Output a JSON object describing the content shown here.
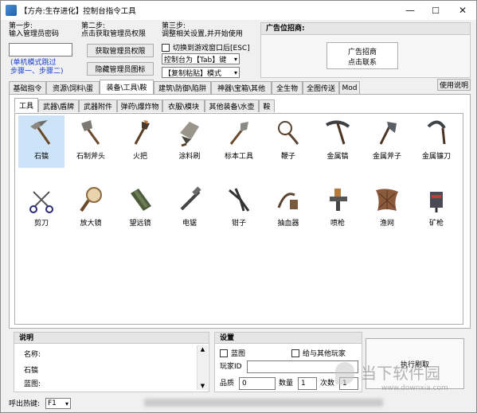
{
  "window": {
    "title": "【方舟:生存进化】控制台指令工具",
    "minimize": "—",
    "maximize": "☐",
    "close": "✕"
  },
  "step1": {
    "title": "第一步:",
    "desc": "输入管理员密码",
    "input_value": "",
    "note_line1": "(单机模式跳过",
    "note_line2": "步骤一、步骤二)"
  },
  "step2": {
    "title": "第二步:",
    "desc": "点击获取管理员权限",
    "get_admin_label": "获取管理员权限",
    "hide_icon_label": "隐藏管理员图标"
  },
  "step3": {
    "title": "第三步:",
    "desc": "调整相关设置,并开始使用",
    "switch_label": "切换到游戏窗口后[ESC]",
    "console_key_label": "控制台为【Tab】键",
    "paste_mode_label": "【复制粘贴】模式"
  },
  "ad": {
    "header": "广告位招商:",
    "box_line1": "广告招商",
    "box_line2": "点击联系"
  },
  "main_tabs": [
    "基础指令",
    "资源\\饲料\\蛋",
    "装备\\工具\\鞍",
    "建筑\\防御\\陷阱",
    "神器\\宝箱\\其他",
    "全生物",
    "全图传送",
    "Mod"
  ],
  "help_button": "使用说明",
  "sub_tabs": [
    "工具",
    "武器\\盾牌",
    "武器附件",
    "弹药\\爆炸物",
    "衣服\\模块",
    "其他装备\\水壶",
    "鞍"
  ],
  "items": [
    {
      "label": "石镐",
      "icon": "stone-pick-icon"
    },
    {
      "label": "石制斧头",
      "icon": "stone-hatchet-icon"
    },
    {
      "label": "火把",
      "icon": "torch-icon"
    },
    {
      "label": "涂料刷",
      "icon": "paintbrush-icon"
    },
    {
      "label": "标本工具",
      "icon": "specimen-tool-icon"
    },
    {
      "label": "鞭子",
      "icon": "whip-icon"
    },
    {
      "label": "金属镐",
      "icon": "metal-pick-icon"
    },
    {
      "label": "金属斧子",
      "icon": "metal-hatchet-icon"
    },
    {
      "label": "金属镰刀",
      "icon": "metal-sickle-icon"
    },
    {
      "label": "剪刀",
      "icon": "scissors-icon"
    },
    {
      "label": "放大镜",
      "icon": "magnifying-glass-icon"
    },
    {
      "label": "望远镜",
      "icon": "spyglass-icon"
    },
    {
      "label": "电锯",
      "icon": "chainsaw-icon"
    },
    {
      "label": "钳子",
      "icon": "pliers-icon"
    },
    {
      "label": "抽血器",
      "icon": "blood-extractor-icon"
    },
    {
      "label": "喷枪",
      "icon": "spray-gun-icon"
    },
    {
      "label": "渔网",
      "icon": "fishing-net-icon"
    },
    {
      "label": "矿枪",
      "icon": "mining-drill-icon"
    }
  ],
  "description": {
    "header": "说明",
    "name_label": "名称:",
    "name_value": "石镐",
    "blueprint_label": "蓝图:"
  },
  "settings": {
    "header": "设置",
    "blueprint_label": "蓝图",
    "give_others_label": "给与其他玩家",
    "player_id_label": "玩家ID",
    "player_id_value": "",
    "quality_label": "品质",
    "quality_value": "0",
    "quantity_label": "数量",
    "quantity_value": "1",
    "times_label": "次数",
    "times_value": "1",
    "execute_label": "执行刷取"
  },
  "footer": {
    "hotkey_label": "呼出热键:",
    "hotkey_value": "F1"
  },
  "watermark": {
    "text": "当下软件园",
    "url": "www.downxia.com"
  }
}
